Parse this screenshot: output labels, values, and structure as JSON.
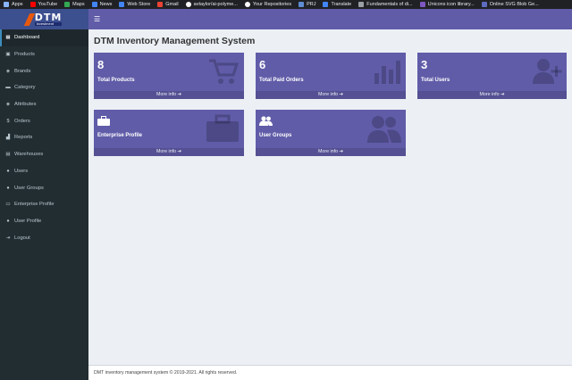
{
  "bookmarks": [
    {
      "label": "Apps",
      "icon": "apps-icon",
      "color": "#8ab4f8"
    },
    {
      "label": "YouTube",
      "icon": "youtube-icon",
      "color": "#ff0000"
    },
    {
      "label": "Maps",
      "icon": "maps-icon",
      "color": "#34a853"
    },
    {
      "label": "News",
      "icon": "news-icon",
      "color": "#4285f4"
    },
    {
      "label": "Web Store",
      "icon": "web-store-icon",
      "color": "#4285f4"
    },
    {
      "label": "Gmail",
      "icon": "gmail-icon",
      "color": "#ea4335"
    },
    {
      "label": "avtaylor/ai-polyme...",
      "icon": "github-icon",
      "color": "#ffffff"
    },
    {
      "label": "Your Repositories",
      "icon": "github-icon",
      "color": "#ffffff"
    },
    {
      "label": "PRJ",
      "icon": "prj-icon",
      "color": "#5f8dd3"
    },
    {
      "label": "Translate",
      "icon": "translate-icon",
      "color": "#4285f4"
    },
    {
      "label": "Fundamentals of di...",
      "icon": "globe-icon",
      "color": "#9aa0a6"
    },
    {
      "label": "Unicons icon library...",
      "icon": "unicons-icon",
      "color": "#7e57c2"
    },
    {
      "label": "Online SVG Blob Ge...",
      "icon": "blob-icon",
      "color": "#5c6bc0"
    }
  ],
  "logo": {
    "main": "DTM",
    "sub": "investment"
  },
  "menu": [
    {
      "label": "Dashboard",
      "icon": "dashboard-icon",
      "glyph": "▦",
      "active": true
    },
    {
      "label": "Products",
      "icon": "cube-icon",
      "glyph": "▣"
    },
    {
      "label": "Brands",
      "icon": "tag-icon",
      "glyph": "◈"
    },
    {
      "label": "Category",
      "icon": "category-icon",
      "glyph": "▬"
    },
    {
      "label": "Attributes",
      "icon": "tag-icon",
      "glyph": "◈"
    },
    {
      "label": "Orders",
      "icon": "dollar-icon",
      "glyph": "$"
    },
    {
      "label": "Reports",
      "icon": "chart-icon",
      "glyph": "▟"
    },
    {
      "label": "Warehouses",
      "icon": "warehouse-icon",
      "glyph": "▤"
    },
    {
      "label": "Users",
      "icon": "user-icon",
      "glyph": "●"
    },
    {
      "label": "User Groups",
      "icon": "users-icon",
      "glyph": "●"
    },
    {
      "label": "Enterprise Profile",
      "icon": "briefcase-icon",
      "glyph": "▭"
    },
    {
      "label": "User Profile",
      "icon": "user-icon",
      "glyph": "●"
    },
    {
      "label": "Logout",
      "icon": "logout-icon",
      "glyph": "⇥"
    }
  ],
  "title": "DTM Inventory Management System",
  "boxes": [
    {
      "number": "8",
      "label": "Total Products",
      "more": "More info ➔",
      "icon": "cart-icon"
    },
    {
      "number": "6",
      "label": "Total Paid Orders",
      "more": "More info ➔",
      "icon": "bar-chart-icon"
    },
    {
      "number": "3",
      "label": "Total Users",
      "more": "More info ➔",
      "icon": "user-plus-icon"
    },
    {
      "number": "",
      "label": "Enterprise Profile",
      "more": "More info ➔",
      "icon": "briefcase-icon"
    },
    {
      "number": "",
      "label": "User Groups",
      "more": "More info ➔",
      "icon": "users-icon"
    }
  ],
  "footer": "DMT inventory management system © 2019-2021. All rights reserved.",
  "colors": {
    "accent": "#605ca8",
    "sidebar": "#222d32",
    "content_bg": "#ecf0f5"
  }
}
